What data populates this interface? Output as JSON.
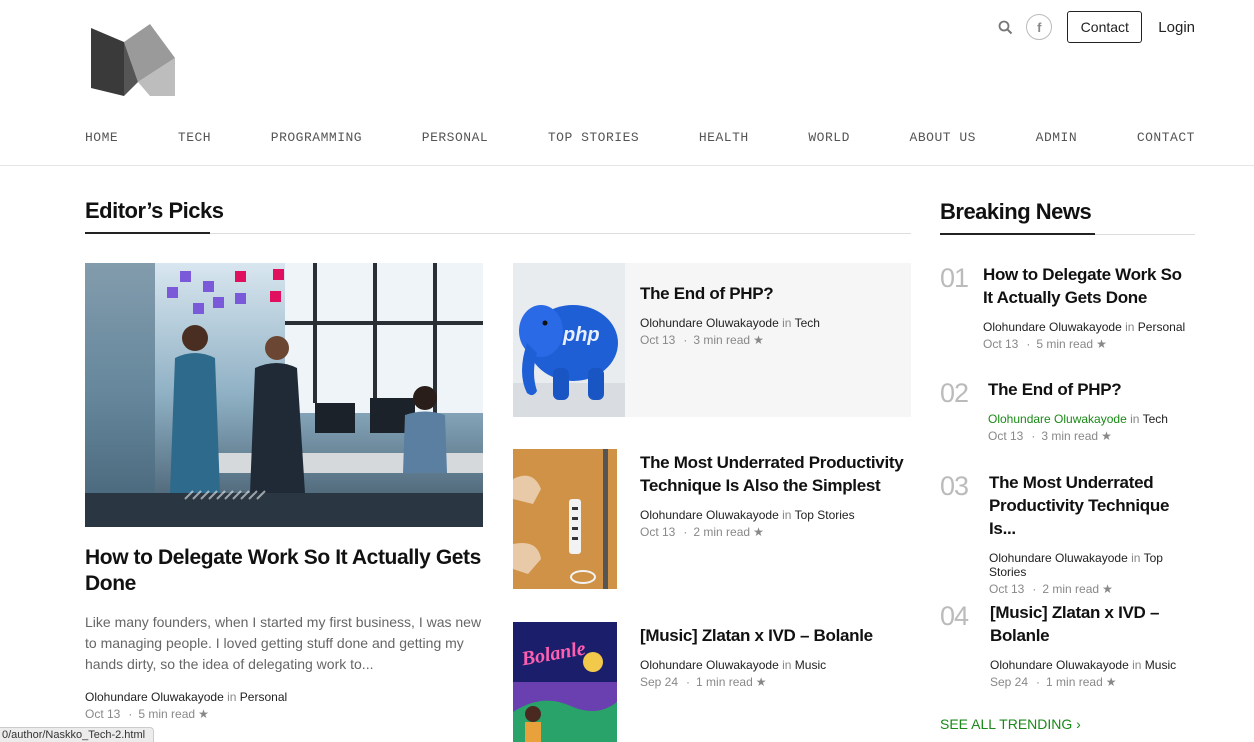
{
  "header": {
    "logo_name": "M",
    "contact_label": "Contact",
    "login_label": "Login",
    "facebook_glyph": "f"
  },
  "nav": [
    "HOME",
    "TECH",
    "PROGRAMMING",
    "PERSONAL",
    "TOP STORIES",
    "HEALTH",
    "WORLD",
    "ABOUT US",
    "ADMIN",
    "CONTACT"
  ],
  "editors": {
    "title": "Editor’s Picks",
    "featured": {
      "title": "How to Delegate Work So It Actually Gets Done",
      "excerpt": "Like many founders, when I started my first business, I was new to managing people. I loved getting stuff done and getting my hands dirty, so the idea of delegating work to...",
      "author": "Olohundare Oluwakayode",
      "in": "in",
      "category": "Personal",
      "date": "Oct 13",
      "read": "5 min read",
      "star": "★"
    },
    "posts": [
      {
        "title": "The End of PHP?",
        "author": "Olohundare Oluwakayode",
        "in": "in",
        "category": "Tech",
        "date": "Oct 13",
        "read": "3 min read",
        "star": "★"
      },
      {
        "title": "The Most Underrated Productivity Technique Is Also the Simplest",
        "author": "Olohundare Oluwakayode",
        "in": "in",
        "category": "Top Stories",
        "date": "Oct 13",
        "read": "2 min read",
        "star": "★"
      },
      {
        "title": "[Music] Zlatan x IVD – Bolanle",
        "author": "Olohundare Oluwakayode",
        "in": "in",
        "category": "Music",
        "date": "Sep 24",
        "read": "1 min read",
        "star": "★"
      }
    ],
    "php_label": "php",
    "bolanle_label": "Bolanle"
  },
  "breaking": {
    "title": "Breaking News",
    "items": [
      {
        "num": "01",
        "title": "How to Delegate Work So It Actually Gets Done",
        "author": "Olohundare Oluwakayode",
        "in": "in",
        "category": "Personal",
        "date": "Oct 13",
        "read": "5 min read",
        "star": "★"
      },
      {
        "num": "02",
        "title": "The End of PHP?",
        "author": "Olohundare Oluwakayode",
        "in": "in",
        "category": "Tech",
        "date": "Oct 13",
        "read": "3 min read",
        "star": "★"
      },
      {
        "num": "03",
        "title": "The Most Underrated Productivity Technique Is...",
        "author": "Olohundare Oluwakayode",
        "in": "in",
        "category": "Top Stories",
        "date": "Oct 13",
        "read": "2 min read",
        "star": "★"
      },
      {
        "num": "04",
        "title": "[Music] Zlatan x IVD – Bolanle",
        "author": "Olohundare Oluwakayode",
        "in": "in",
        "category": "Music",
        "date": "Sep 24",
        "read": "1 min read",
        "star": "★"
      }
    ],
    "see_all": "SEE ALL TRENDING",
    "see_all_chevron": "›"
  },
  "status_url": "0/author/Naskko_Tech-2.html",
  "colors": {
    "accent_green": "#1a8917",
    "text": "#222222",
    "muted": "#888888"
  }
}
